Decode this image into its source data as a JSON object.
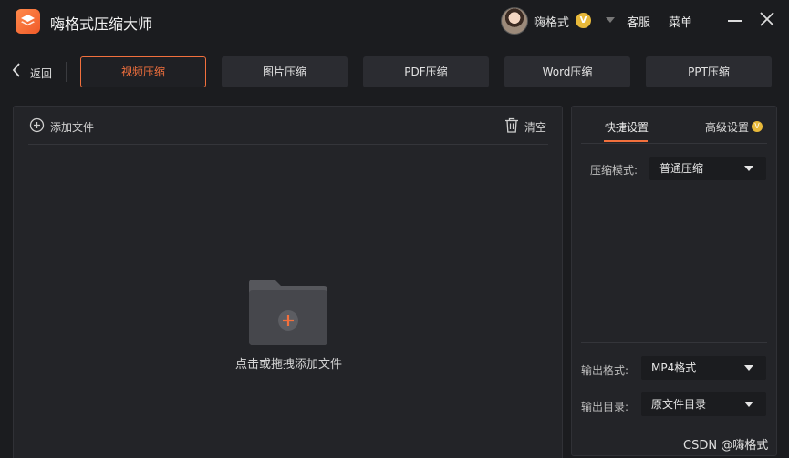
{
  "app": {
    "title": "嗨格式压缩大师",
    "logo_icon": "layers-icon",
    "accent": "#f2703d"
  },
  "header": {
    "username": "嗨格式",
    "vip_badge": "V",
    "service": "客服",
    "menu": "菜单"
  },
  "nav": {
    "back": "返回",
    "tabs": [
      {
        "label": "视频压缩",
        "active": true
      },
      {
        "label": "图片压缩",
        "active": false
      },
      {
        "label": "PDF压缩",
        "active": false
      },
      {
        "label": "Word压缩",
        "active": false
      },
      {
        "label": "PPT压缩",
        "active": false
      }
    ]
  },
  "file_panel": {
    "add_file": "添加文件",
    "clear": "清空",
    "drop_hint": "点击或拖拽添加文件"
  },
  "settings": {
    "tabs": {
      "quick": "快捷设置",
      "advanced": "高级设置"
    },
    "compress_mode": {
      "label": "压缩模式:",
      "value": "普通压缩"
    },
    "output_format": {
      "label": "输出格式:",
      "value": "MP4格式"
    },
    "output_dir": {
      "label": "输出目录:",
      "value": "原文件目录"
    }
  },
  "watermark": "CSDN @嗨格式"
}
